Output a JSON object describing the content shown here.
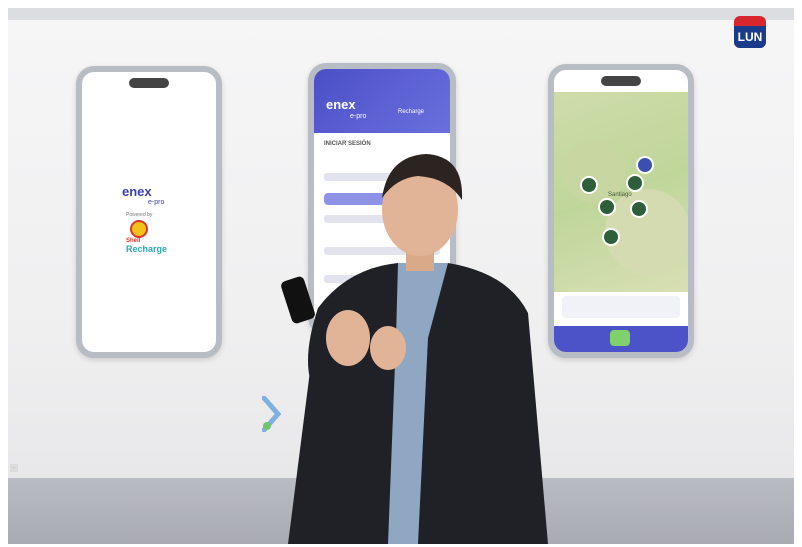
{
  "photo": {
    "brand_badge": "LUN",
    "colors": {
      "brand_primary": "#3d3fae",
      "badge_red": "#d8262e",
      "badge_blue": "#1a3b8a"
    },
    "phones": {
      "left": {
        "logo": "enex",
        "logo_sub": "e-pro",
        "powered_by": "Powered by",
        "partner_top": "Shell",
        "partner_bottom": "Recharge"
      },
      "center": {
        "logo": "enex",
        "logo_sub": "e-pro",
        "partner": "Recharge",
        "heading": "INICIAR SESIÓN"
      },
      "right": {
        "map_label": "Santiago"
      }
    }
  }
}
